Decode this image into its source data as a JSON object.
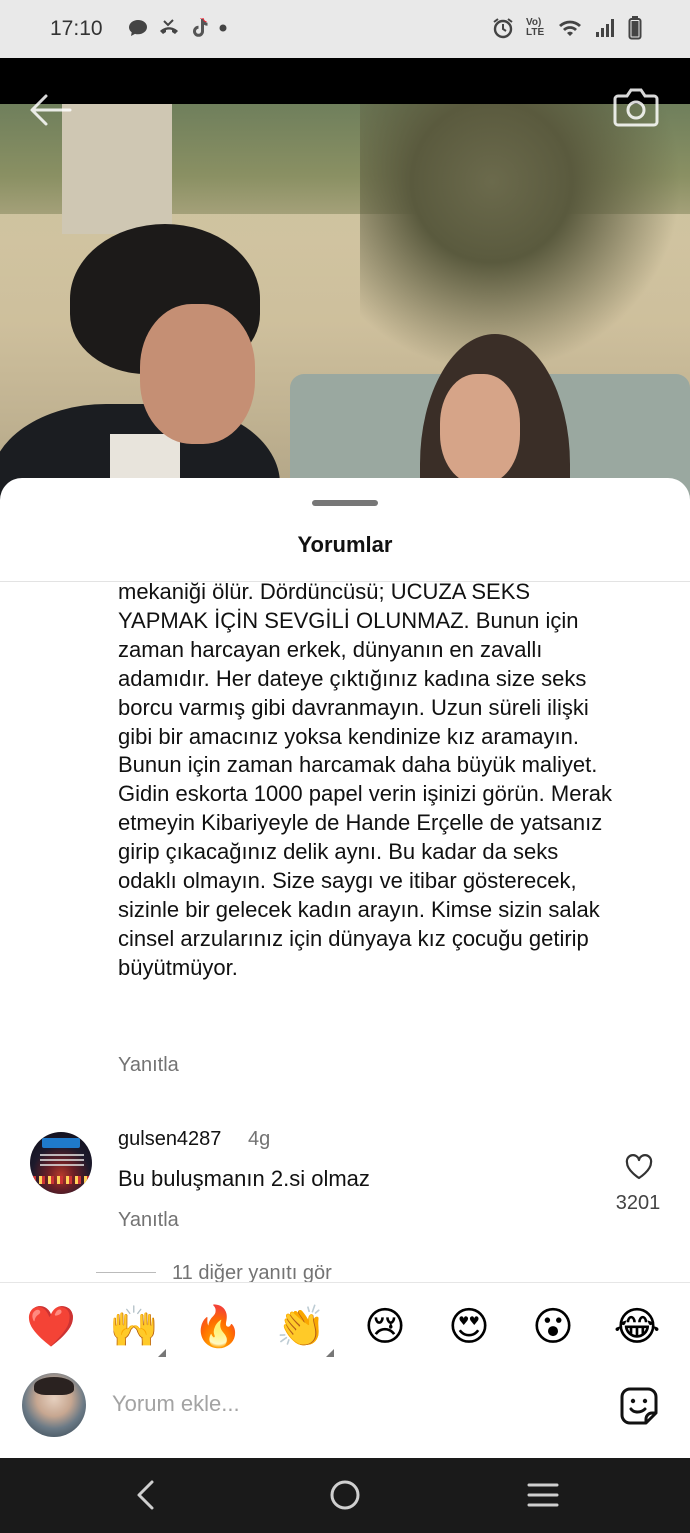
{
  "status_bar": {
    "time": "17:10",
    "left_icons": [
      "chat-bubble-icon",
      "missed-call-icon",
      "tiktok-icon",
      "dot-icon"
    ],
    "right_icons": [
      "alarm-icon",
      "volte-icon",
      "wifi-icon",
      "signal-icon",
      "battery-icon"
    ],
    "volte_label": "Vo) LTE"
  },
  "header": {
    "back_icon": "back-arrow-icon",
    "camera_icon": "camera-icon"
  },
  "sheet": {
    "title": "Yorumlar",
    "comments": [
      {
        "text": "mekaniği ölür. Dördüncüsü; UCUZA SEKS YAPMAK İÇİN SEVGİLİ OLUNMAZ. Bunun için zaman harcayan erkek, dünyanın en zavallı adamıdır. Her dateye çıktığınız kadına size seks borcu varmış gibi davranmayın. Uzun süreli ilişki gibi bir amacınız yoksa kendinize kız aramayın. Bunun için zaman harcamak daha büyük maliyet. Gidin eskorta 1000 papel verin işinizi görün. Merak etmeyin Kibariyeyle de Hande Erçelle de yatsanız girip çıkacağınız delik aynı. Bu kadar da seks odaklı olmayın. Size saygı ve itibar gösterecek, sizinle bir gelecek kadın arayın. Kimse sizin salak cinsel arzularınız için dünyaya kız çocuğu getirip büyütmüyor.",
        "reply_label": "Yanıtla"
      },
      {
        "username": "gulsen4287",
        "time": "4g",
        "text": "Bu buluşmanın 2.si olmaz",
        "reply_label": "Yanıtla",
        "like_count": "3201",
        "view_more_replies": "11 diğer yanıtı gör"
      }
    ]
  },
  "emoji_bar": [
    "❤️",
    "🙌",
    "🔥",
    "👏",
    "😢",
    "😍",
    "😮",
    "😂"
  ],
  "input": {
    "placeholder": "Yorum ekle..."
  },
  "nav_bar": [
    "back-nav-icon",
    "home-nav-icon",
    "recents-nav-icon"
  ]
}
